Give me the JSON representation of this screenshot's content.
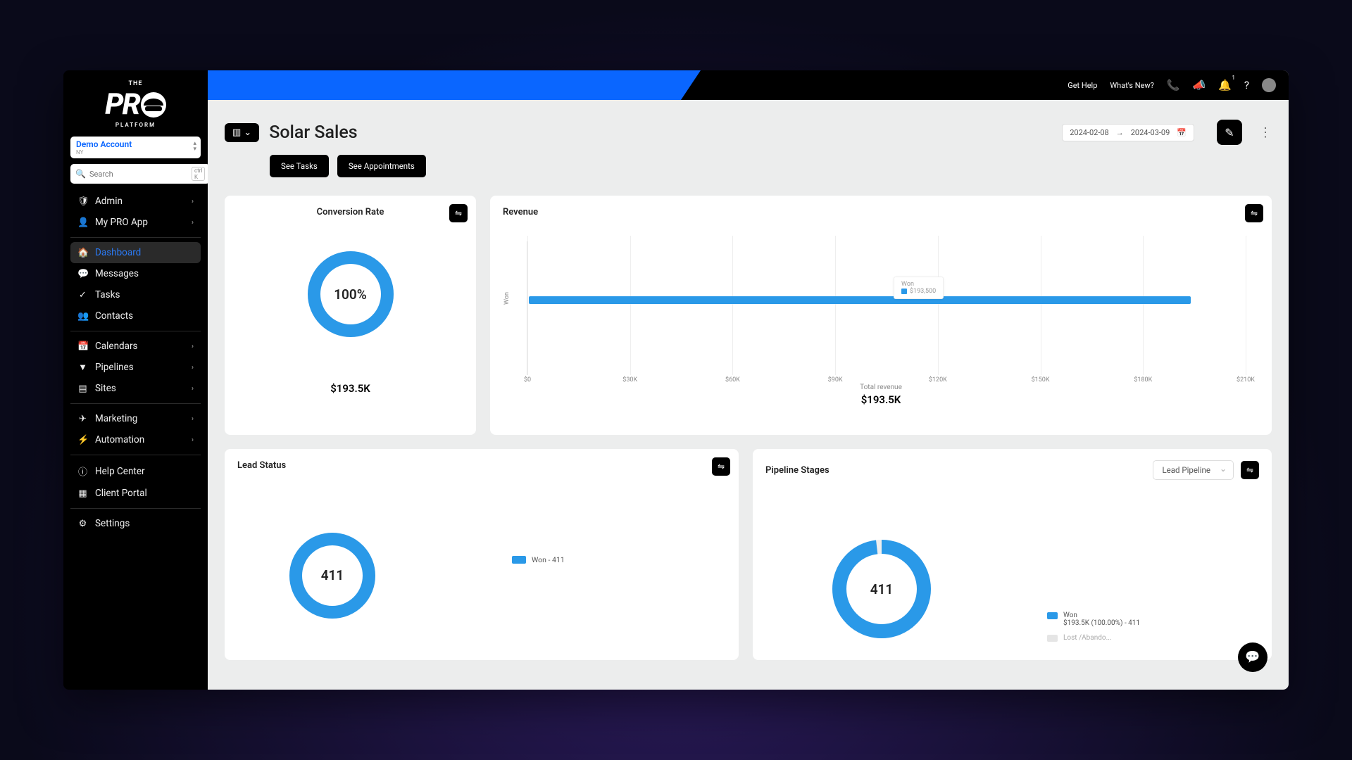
{
  "logo": {
    "top": "THE",
    "main": "PR",
    "sub": "PLATFORM"
  },
  "account": {
    "name": "Demo Account",
    "loc": "NY"
  },
  "search": {
    "placeholder": "Search",
    "kbd": "ctrl K"
  },
  "nav": {
    "admin": "Admin",
    "myapp": "My PRO App",
    "dashboard": "Dashboard",
    "messages": "Messages",
    "tasks": "Tasks",
    "contacts": "Contacts",
    "calendars": "Calendars",
    "pipelines": "Pipelines",
    "sites": "Sites",
    "marketing": "Marketing",
    "automation": "Automation",
    "helpcenter": "Help Center",
    "clientportal": "Client Portal",
    "settings": "Settings"
  },
  "topbar": {
    "gethelp": "Get Help",
    "new": "What's New?",
    "badge": "1"
  },
  "page": {
    "title": "Solar Sales",
    "see_tasks": "See Tasks",
    "see_appts": "See Appointments",
    "date_from": "2024-02-08",
    "date_to": "2024-03-09"
  },
  "cards": {
    "cr": {
      "title": "Conversion Rate",
      "pct": "100%",
      "amount": "$193.5K"
    },
    "rev": {
      "title": "Revenue",
      "ylabel": "Won",
      "total_label": "Total revenue",
      "amount": "$193.5K",
      "tooltip_1": "Won",
      "tooltip_2": "$193,500"
    },
    "ls": {
      "title": "Lead Status",
      "center": "411",
      "legend": "Won - 411"
    },
    "ps": {
      "title": "Pipeline Stages",
      "center": "411",
      "select": "Lead Pipeline",
      "leg1_name": "Won",
      "leg1_detail": "$193.5K (100.00%) - 411",
      "leg2_name": "Lost /Abando..."
    }
  },
  "chart_data": [
    {
      "type": "pie",
      "title": "Conversion Rate",
      "series": [
        {
          "name": "Won",
          "values": [
            100
          ]
        }
      ],
      "categories": [
        "Won"
      ]
    },
    {
      "type": "bar",
      "title": "Revenue",
      "categories": [
        "Won"
      ],
      "values": [
        193500
      ],
      "xlabel": "Total revenue",
      "ylabel": "",
      "xlim": [
        0,
        210000
      ],
      "ticks": [
        "$0",
        "$30K",
        "$60K",
        "$90K",
        "$120K",
        "$150K",
        "$180K",
        "$210K"
      ]
    },
    {
      "type": "pie",
      "title": "Lead Status",
      "categories": [
        "Won"
      ],
      "values": [
        411
      ]
    },
    {
      "type": "pie",
      "title": "Pipeline Stages",
      "categories": [
        "Won",
        "Lost /Abandoned"
      ],
      "values": [
        411,
        0
      ]
    }
  ]
}
